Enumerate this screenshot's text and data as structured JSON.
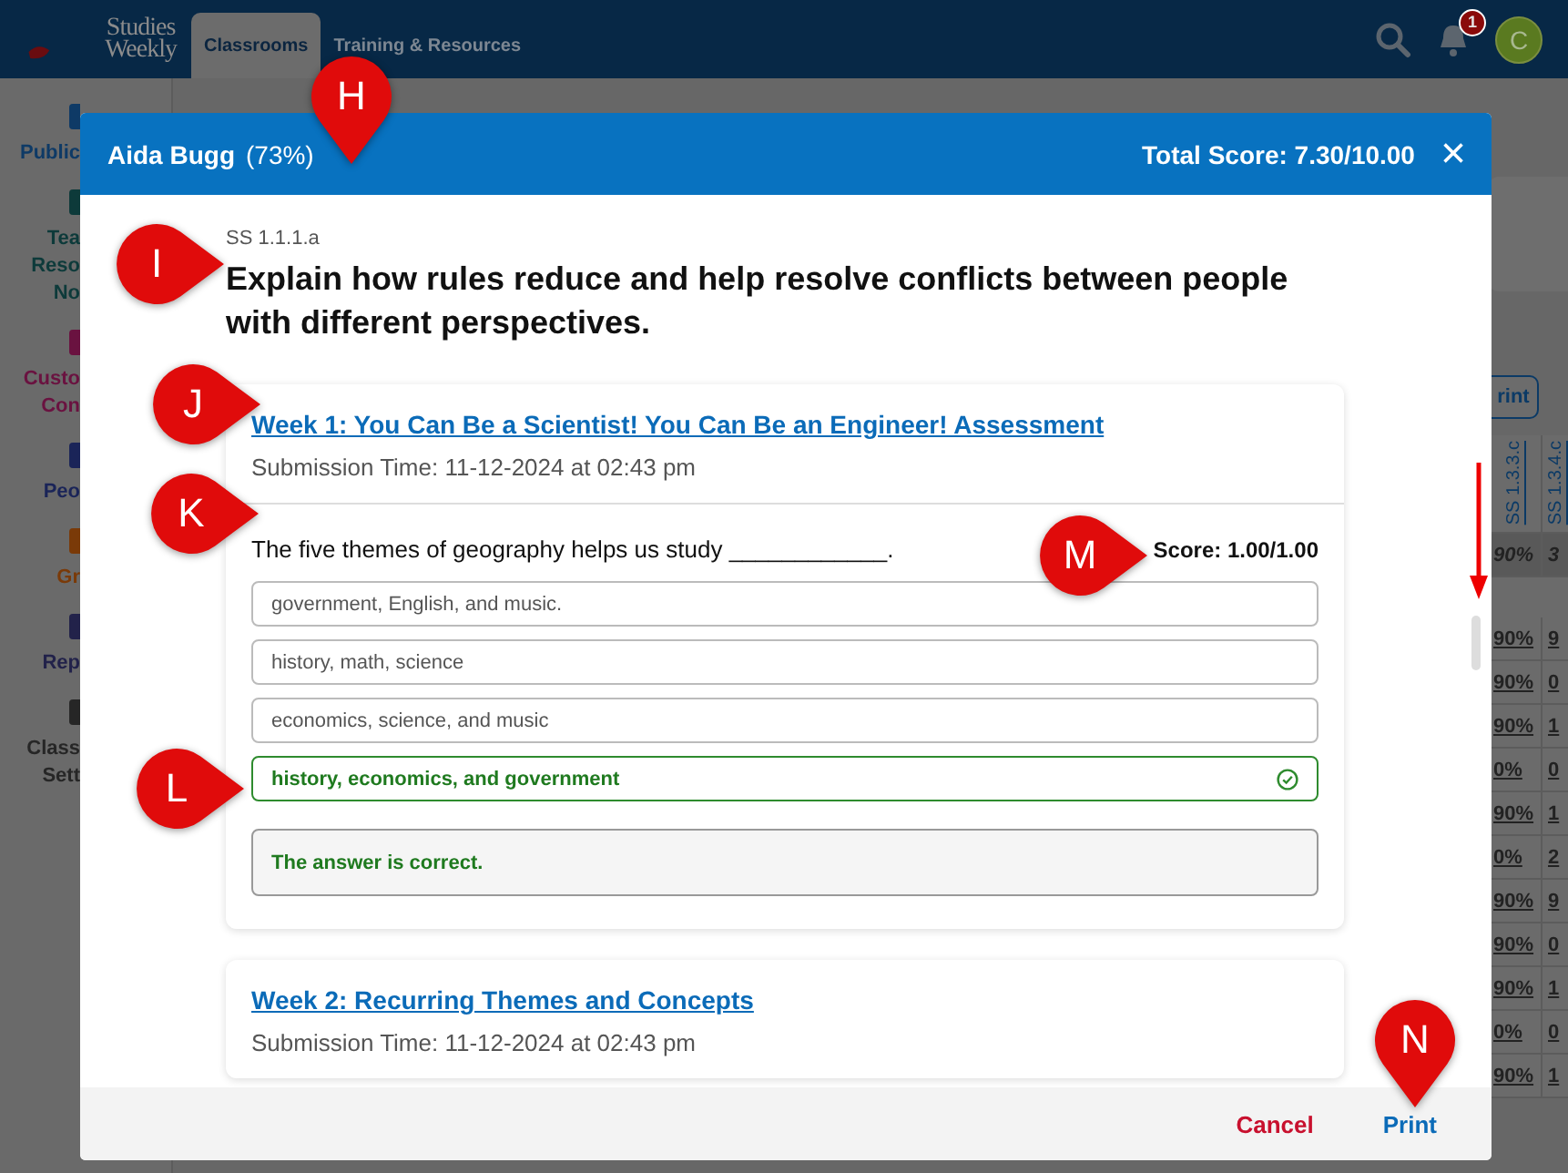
{
  "app_header": {
    "logo_lines": [
      "Studies",
      "Weekly"
    ],
    "tabs": [
      {
        "label": "Classrooms",
        "selected": true
      },
      {
        "label": "Training & Resources",
        "selected": false
      }
    ],
    "notification_count": "1",
    "avatar_initial": "C"
  },
  "sidebar": {
    "items": [
      {
        "lines": [
          "Public"
        ],
        "color": "#0e3a66"
      },
      {
        "lines": [
          "Tea",
          "Reso",
          "No"
        ],
        "color": "#0d3a3a"
      },
      {
        "lines": [
          "Custo",
          "Con"
        ],
        "color": "#6a1240"
      },
      {
        "lines": [
          "Peo"
        ],
        "color": "#1a2458"
      },
      {
        "lines": [
          "Gr"
        ],
        "color": "#7a3a08"
      },
      {
        "lines": [
          "Rep"
        ],
        "color": "#22224a"
      },
      {
        "lines": [
          "Class",
          "Sett"
        ],
        "color": "#262626"
      }
    ]
  },
  "background_table": {
    "print_button": "rint",
    "columns": [
      "SS 1.3.3.c",
      "SS 1.3.4.c"
    ],
    "summary_row": [
      "90%",
      "3"
    ],
    "rows": [
      [
        "90%",
        "9"
      ],
      [
        "90%",
        "0"
      ],
      [
        "90%",
        "1"
      ],
      [
        "0%",
        "0"
      ],
      [
        "90%",
        "1"
      ],
      [
        "0%",
        "2"
      ],
      [
        "90%",
        "9"
      ],
      [
        "90%",
        "0"
      ],
      [
        "90%",
        "1"
      ],
      [
        "0%",
        "0"
      ],
      [
        "90%",
        "1"
      ]
    ]
  },
  "modal": {
    "student_name": "Aida Bugg",
    "percent": "(73%)",
    "total_score": "Total Score: 7.30/10.00",
    "close": "×",
    "standard": "SS 1.1.1.a",
    "question_heading": "Explain how rules reduce and help resolve conflicts between people with different perspectives.",
    "submissions": [
      {
        "title": "Week 1: You Can Be a Scientist! You Can Be an Engineer! Assessment",
        "submission_time": "Submission Time: 11-12-2024 at 02:43 pm",
        "question": "The five themes of geography helps us study ____________.",
        "score": "Score: 1.00/1.00",
        "options": [
          {
            "text": "government, English, and music.",
            "selected": false
          },
          {
            "text": "history, math, science",
            "selected": false
          },
          {
            "text": "economics, science, and music",
            "selected": false
          },
          {
            "text": "history, economics, and government",
            "selected": true
          }
        ],
        "feedback": {
          "text": "The answer is correct.",
          "correct": true
        }
      },
      {
        "title": "Week 2: Recurring Themes and Concepts",
        "submission_time": "Submission Time: 11-12-2024 at 02:43 pm"
      }
    ],
    "buttons": [
      {
        "label": "Cancel",
        "kind": "cancel"
      },
      {
        "label": "Print",
        "kind": "primary"
      }
    ]
  },
  "annotations": [
    {
      "label": "H",
      "kind": "down"
    },
    {
      "label": "I",
      "kind": "right"
    },
    {
      "label": "J",
      "kind": "right"
    },
    {
      "label": "K",
      "kind": "right"
    },
    {
      "label": "L",
      "kind": "right"
    },
    {
      "label": "M",
      "kind": "right"
    },
    {
      "label": "N",
      "kind": "down"
    }
  ]
}
